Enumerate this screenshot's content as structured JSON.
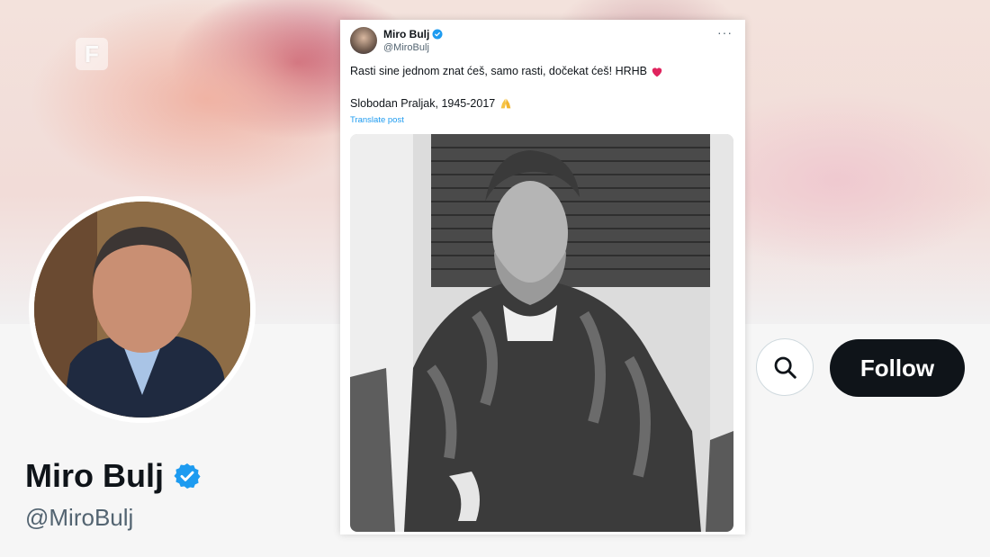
{
  "channel": {
    "logo_letter": "F"
  },
  "profile": {
    "name": "Miro Bulj",
    "handle": "@MiroBulj",
    "follow_label": "Follow",
    "search_icon": "search-icon"
  },
  "tweet": {
    "author_name": "Miro Bulj",
    "author_handle": "@MiroBulj",
    "more": "···",
    "text_line1": "Rasti sine jednom znat ćeš, samo rasti, dočekat ćeš! HRHB",
    "text_line2": "Slobodan Praljak, 1945-2017",
    "translate": "Translate post",
    "emoji_heart": "heart-icon",
    "emoji_pray": "pray-icon"
  },
  "colors": {
    "verified": "#1d9bf0",
    "follow_bg": "#0f1419",
    "heart": "#e0245e"
  }
}
